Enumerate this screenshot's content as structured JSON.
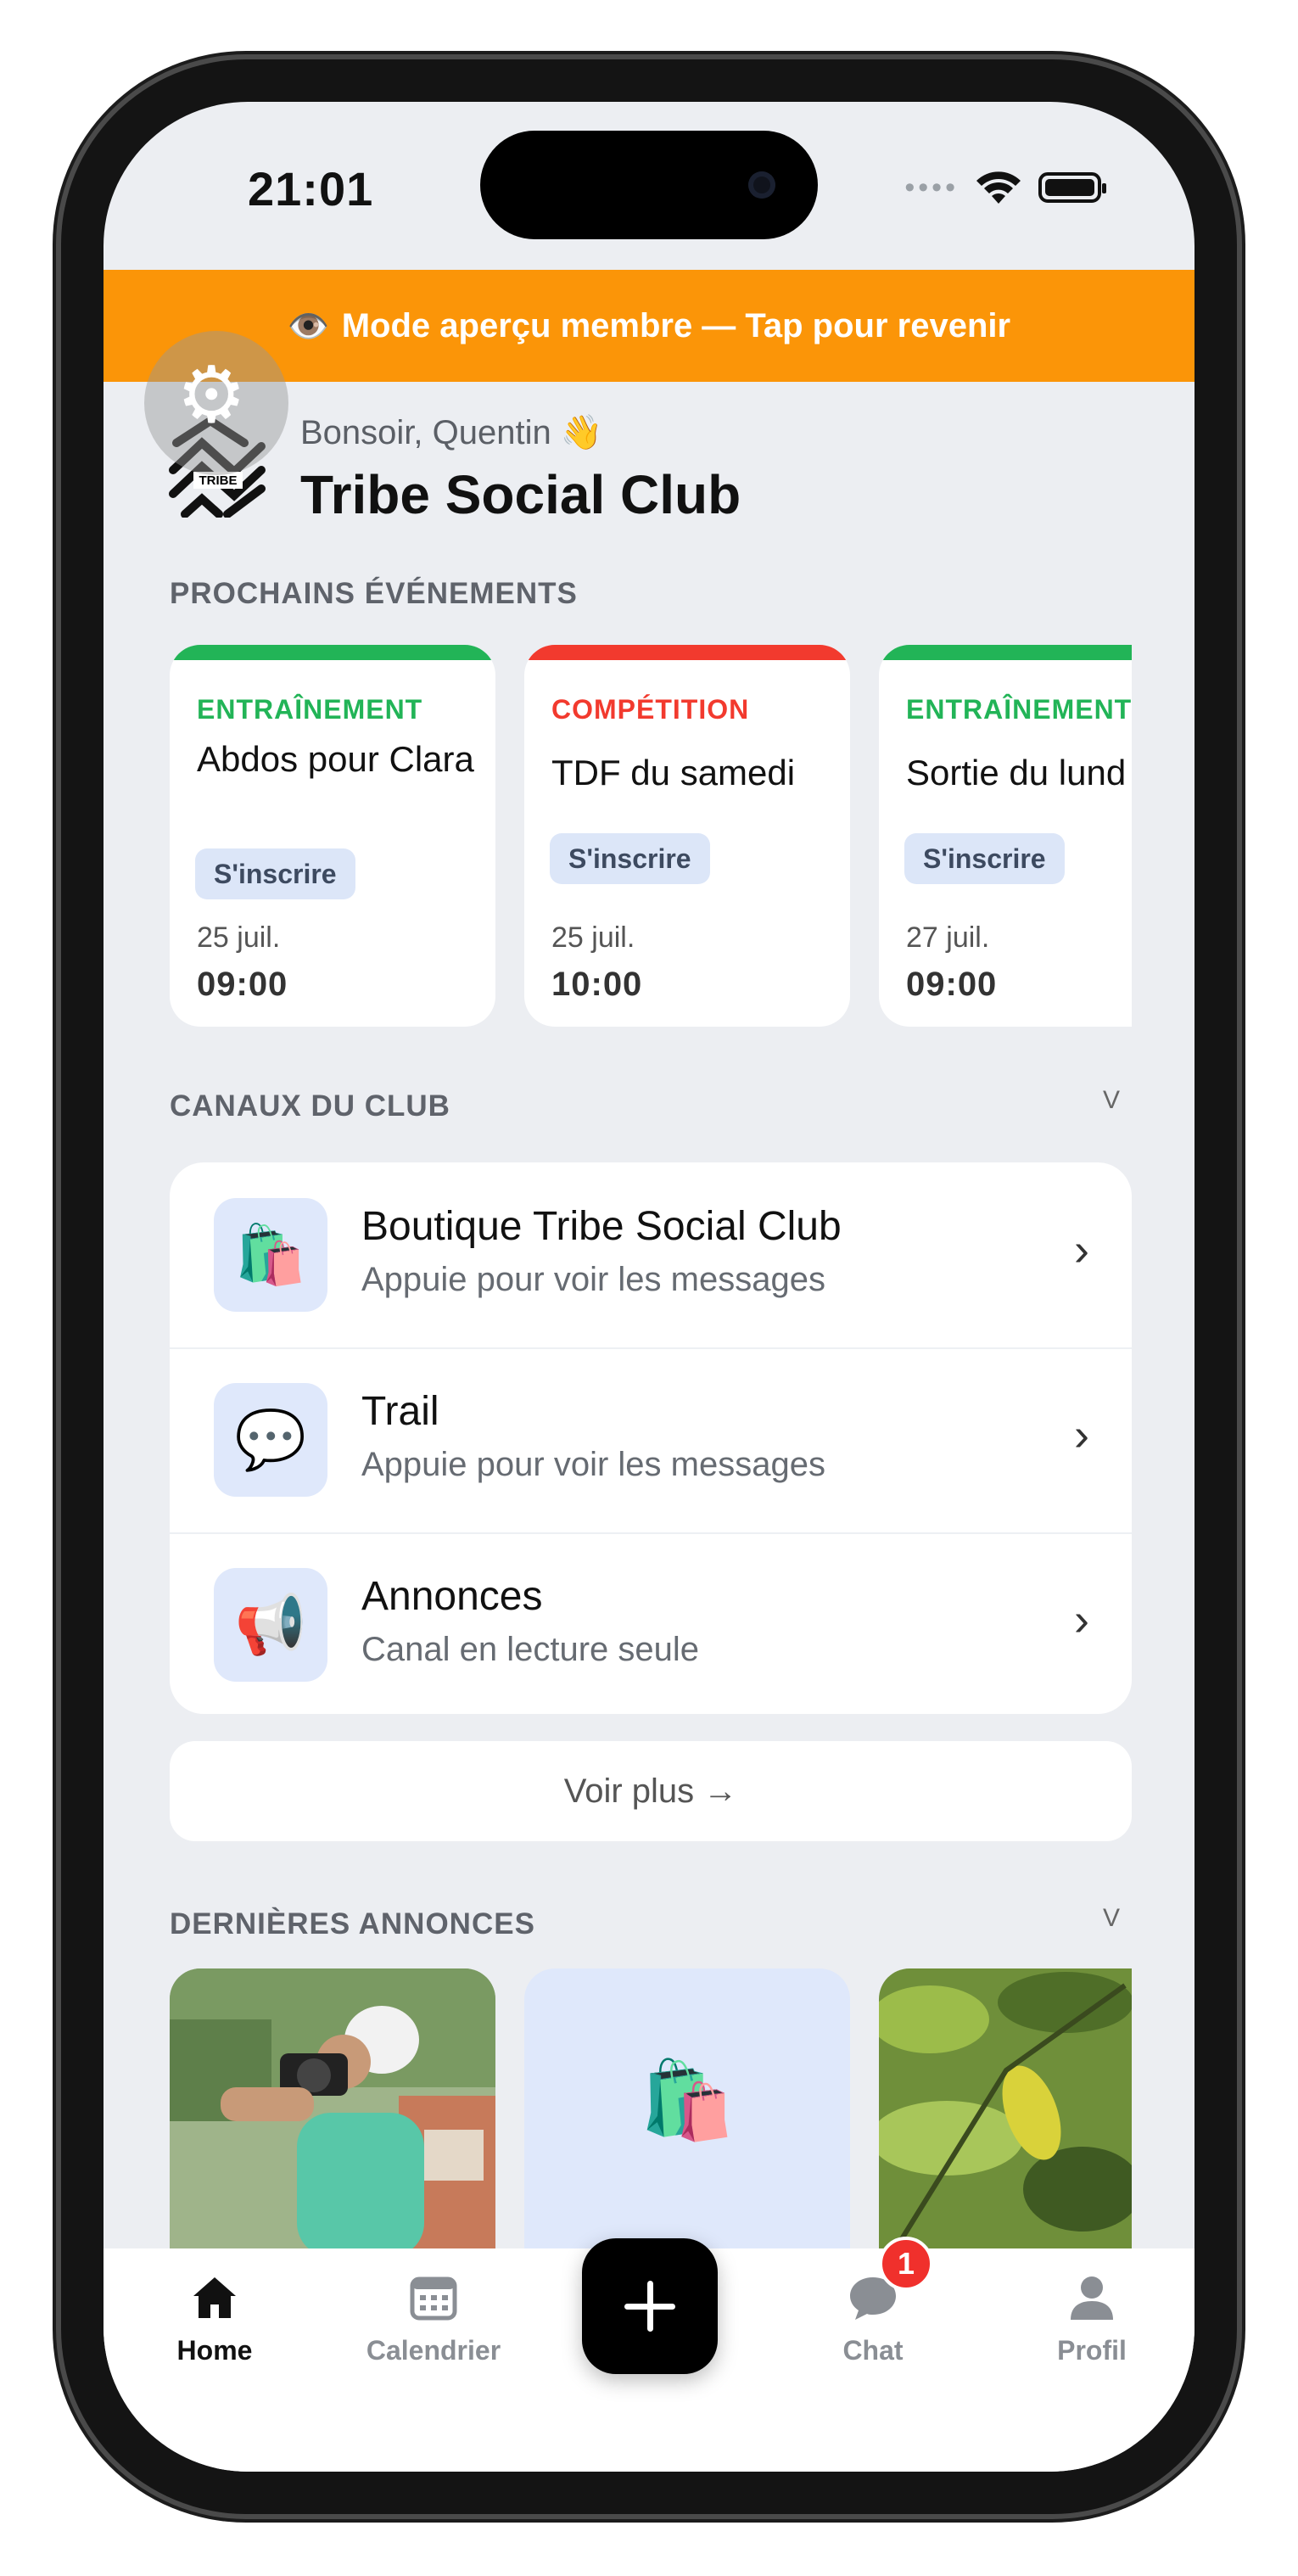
{
  "status_bar": {
    "time": "21:01"
  },
  "banner": {
    "icon": "👁️",
    "text": "Mode aperçu membre — Tap pour revenir"
  },
  "header": {
    "greeting": "Bonsoir, Quentin 👋",
    "club_name": "Tribe Social Club",
    "logo_text": "TRIBE"
  },
  "events": {
    "section_title": "PROCHAINS ÉVÉNEMENTS",
    "items": [
      {
        "category": "ENTRAÎNEMENT",
        "category_color": "#22b457",
        "title": "Abdos pour Clara",
        "action": "S'inscrire",
        "date": "25 juil.",
        "time": "09:00"
      },
      {
        "category": "COMPÉTITION",
        "category_color": "#f23a2e",
        "title": "TDF du samedi",
        "action": "S'inscrire",
        "date": "25 juil.",
        "time": "10:00"
      },
      {
        "category": "ENTRAÎNEMENT",
        "category_color": "#22b457",
        "title": "Sortie du lund",
        "action": "S'inscrire",
        "date": "27 juil.",
        "time": "09:00"
      }
    ]
  },
  "channels": {
    "section_title": "CANAUX DU CLUB",
    "toggle": "V",
    "items": [
      {
        "icon": "🛍️",
        "icon_name": "shopping-bags-icon",
        "title": "Boutique Tribe Social Club",
        "subtitle": "Appuie pour voir les messages"
      },
      {
        "icon": "💬",
        "icon_name": "speech-bubble-icon",
        "title": "Trail",
        "subtitle": "Appuie pour voir les messages"
      },
      {
        "icon": "📢",
        "icon_name": "megaphone-icon",
        "title": "Annonces",
        "subtitle": "Canal en lecture seule"
      }
    ],
    "more": "Voir plus →"
  },
  "announcements": {
    "section_title": "DERNIÈRES ANNONCES",
    "toggle": "V",
    "middle_icon": "🛍️"
  },
  "tabbar": {
    "home": "Home",
    "calendar": "Calendrier",
    "chat": "Chat",
    "chat_badge": "1",
    "profile": "Profil"
  },
  "colors": {
    "banner": "#fb9508",
    "accent_green": "#22b457",
    "accent_red": "#f23a2e",
    "badge": "#f0302c"
  }
}
